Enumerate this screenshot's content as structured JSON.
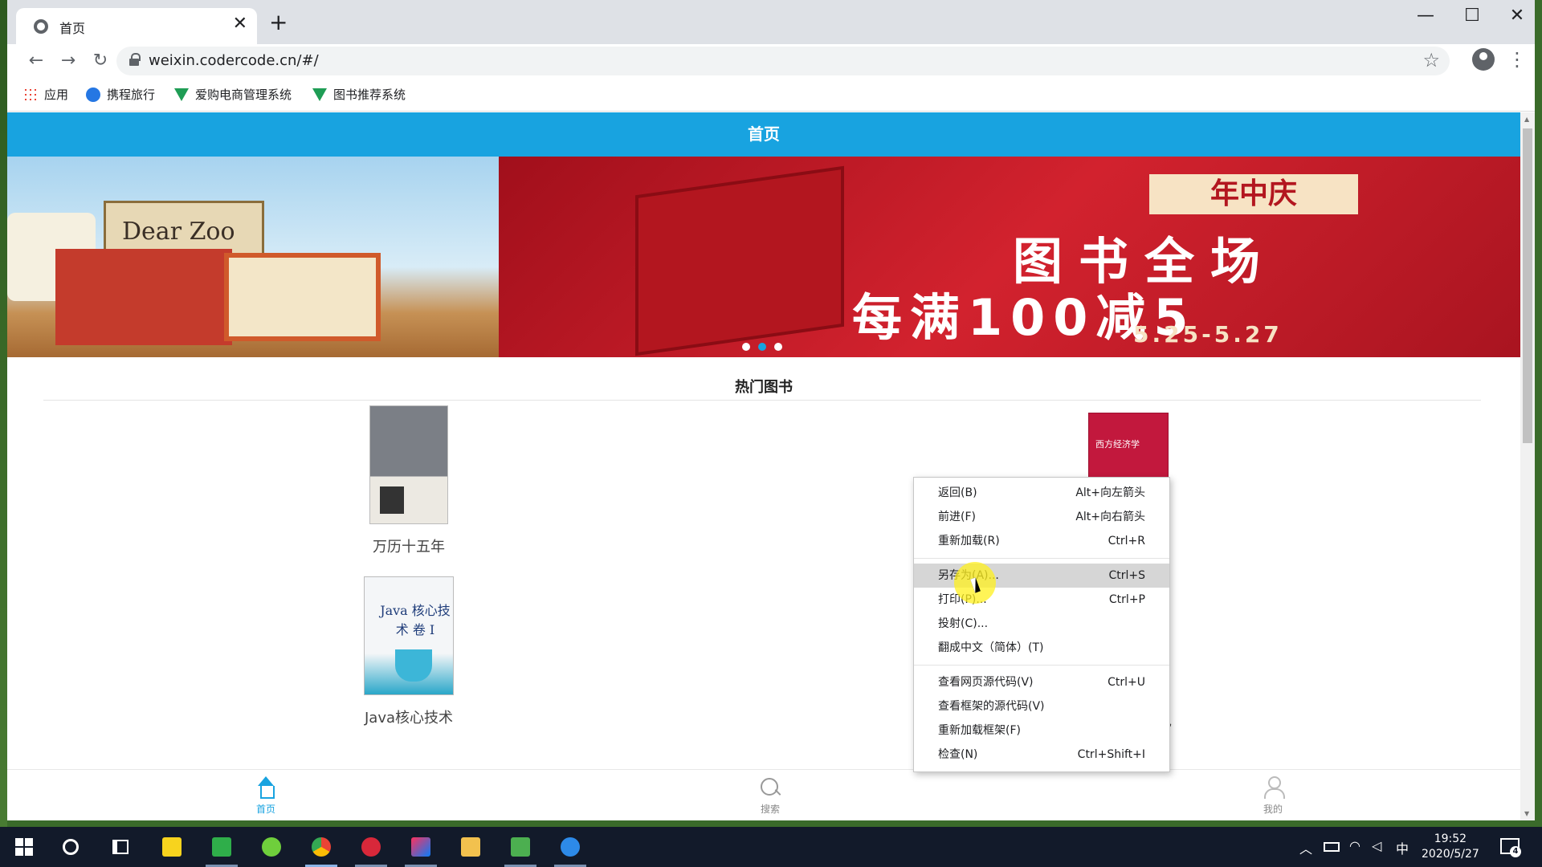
{
  "browser": {
    "tab_title": "首页",
    "tab_close": "✕",
    "new_tab": "+",
    "url": "weixin.codercode.cn/#/",
    "window_controls": {
      "minimize": "—",
      "maximize": "☐",
      "close": "✕"
    },
    "nav": {
      "back": "←",
      "forward": "→",
      "reload": "↻"
    },
    "star": "☆",
    "menu": "⋮",
    "bookmarks": [
      {
        "label": "应用",
        "icon": "apps-icon"
      },
      {
        "label": "携程旅行",
        "icon": "ctrip-icon"
      },
      {
        "label": "爱购电商管理系统",
        "icon": "vue-icon"
      },
      {
        "label": "图书推荐系统",
        "icon": "vue-icon"
      }
    ]
  },
  "page": {
    "header_title": "首页",
    "banner": {
      "left_book_title": "Dear Zoo",
      "tag": "年中庆",
      "line1": "图书全场",
      "line2": "每满100减5",
      "date": "5.25-5.27",
      "active_slide": 2,
      "slide_count": 3
    },
    "section_title": "热门图书",
    "books": [
      {
        "title": "万历十五年"
      },
      {
        "title": "Java核心技术",
        "cover_text": "Java 核心技术 卷 I"
      },
      {
        "title": "",
        "cover_text": "西方经济学"
      }
    ],
    "partial_text": "己",
    "tabbar": [
      {
        "label": "首页",
        "icon": "home-icon",
        "active": true
      },
      {
        "label": "搜索",
        "icon": "search-icon",
        "active": false
      },
      {
        "label": "我的",
        "icon": "user-icon",
        "active": false
      }
    ]
  },
  "context_menu": {
    "groups": [
      [
        {
          "label": "返回(B)",
          "shortcut": "Alt+向左箭头"
        },
        {
          "label": "前进(F)",
          "shortcut": "Alt+向右箭头"
        },
        {
          "label": "重新加载(R)",
          "shortcut": "Ctrl+R"
        }
      ],
      [
        {
          "label": "另存为(A)...",
          "shortcut": "Ctrl+S",
          "highlighted": true
        },
        {
          "label": "打印(P)...",
          "shortcut": "Ctrl+P"
        },
        {
          "label": "投射(C)...",
          "shortcut": ""
        },
        {
          "label": "翻成中文（简体）(T)",
          "shortcut": ""
        }
      ],
      [
        {
          "label": "查看网页源代码(V)",
          "shortcut": "Ctrl+U"
        },
        {
          "label": "查看框架的源代码(V)",
          "shortcut": ""
        },
        {
          "label": "重新加载框架(F)",
          "shortcut": ""
        },
        {
          "label": "检查(N)",
          "shortcut": "Ctrl+Shift+I"
        }
      ]
    ]
  },
  "taskbar": {
    "apps": [
      "start",
      "cortana",
      "task-view",
      "sticky-notes",
      "hbuilder",
      "app-green",
      "chrome",
      "app-red",
      "intellij",
      "file-explorer",
      "app-excel",
      "sogou"
    ],
    "tray": {
      "chevron": "︿",
      "ime": "中"
    },
    "time": "19:52",
    "date": "2020/5/27",
    "notification_count": "4"
  },
  "colors": {
    "header": "#18a3e0",
    "banner_red": "#d2222e",
    "taskbar": "#121a2a",
    "menu_highlight": "#d6d6d6"
  }
}
